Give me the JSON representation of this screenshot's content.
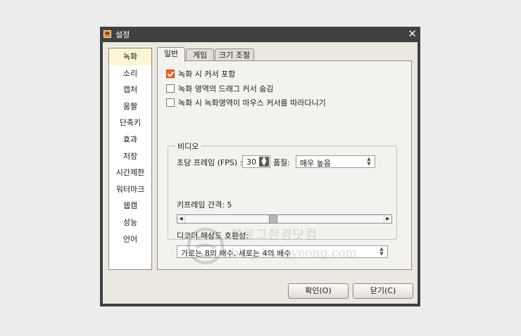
{
  "window": {
    "title": "설정",
    "close_glyph": "✕",
    "icon": "app-icon"
  },
  "sidebar": {
    "items": [
      {
        "label": "녹화",
        "selected": true
      },
      {
        "label": "소리"
      },
      {
        "label": "캡처"
      },
      {
        "label": "움짤"
      },
      {
        "label": "단축키"
      },
      {
        "label": "효과"
      },
      {
        "label": "저장"
      },
      {
        "label": "시간제한"
      },
      {
        "label": "워터마크"
      },
      {
        "label": "웹캠"
      },
      {
        "label": "성능"
      },
      {
        "label": "언어"
      }
    ]
  },
  "tabs": [
    {
      "label": "일반",
      "active": true
    },
    {
      "label": "게임"
    },
    {
      "label": "크기 조절"
    }
  ],
  "options": {
    "show_cursor": {
      "label": "녹화 시 커서 포함",
      "checked": true
    },
    "hide_drag_cursor": {
      "label": "녹화 영역의 드래그 커서 숨김",
      "checked": false
    },
    "follow_cursor": {
      "label": "녹화 시 녹화영역이 마우스 커서를 따라다니기",
      "checked": false
    }
  },
  "video": {
    "group_title": "비디오",
    "fps_label": "초당 프레임 (FPS) :",
    "fps_value": "30",
    "quality_label": "품질:",
    "quality_value": "매우 높음",
    "keyframe_label": "키프레임 간격: 5",
    "keyframe_value": 5,
    "keyframe_position_fraction": 0.44,
    "decoder_label": "디코더 해상도 호환성:",
    "decoder_value": "가로는 8의 배수, 세로는 4의 배수"
  },
  "watermark": {
    "line1": "블로그한경닷컴",
    "line2": "blog.hangyeong.com"
  },
  "buttons": {
    "ok": "확인(O)",
    "close": "닫기(C)"
  },
  "colors": {
    "accent_check": "#e9672c",
    "titlebar": "#414141",
    "sidebar_selected": "#fdf6d3"
  }
}
